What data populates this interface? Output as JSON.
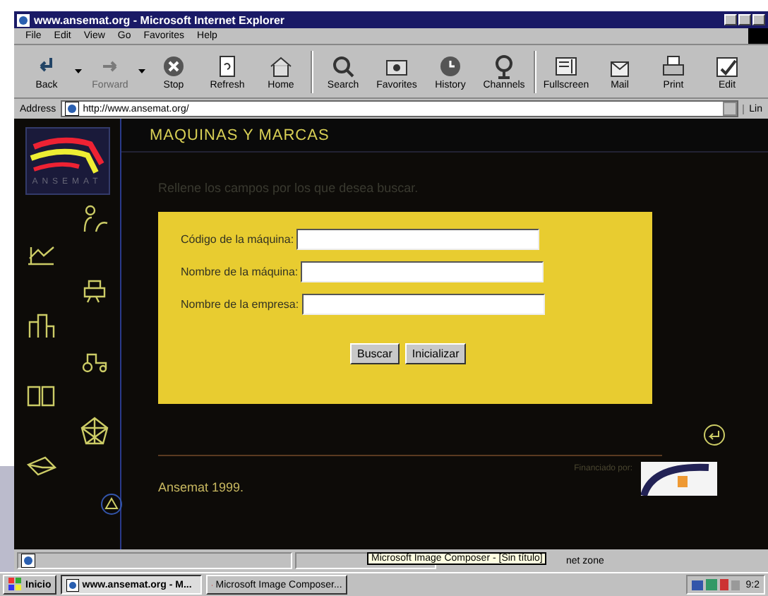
{
  "window": {
    "title": "www.ansemat.org - Microsoft Internet Explorer"
  },
  "menu": [
    "File",
    "Edit",
    "View",
    "Go",
    "Favorites",
    "Help"
  ],
  "toolbar": [
    {
      "label": "Back",
      "kind": "back",
      "disabled": false,
      "dropdown": true
    },
    {
      "label": "Forward",
      "kind": "forward",
      "disabled": true,
      "dropdown": true
    },
    {
      "label": "Stop",
      "kind": "stop",
      "disabled": false,
      "dropdown": false
    },
    {
      "label": "Refresh",
      "kind": "refresh",
      "disabled": false,
      "dropdown": false
    },
    {
      "label": "Home",
      "kind": "home",
      "disabled": false,
      "dropdown": false
    },
    {
      "label": "Search",
      "kind": "search",
      "disabled": false,
      "dropdown": false
    },
    {
      "label": "Favorites",
      "kind": "favorites",
      "disabled": false,
      "dropdown": false
    },
    {
      "label": "History",
      "kind": "history",
      "disabled": false,
      "dropdown": false
    },
    {
      "label": "Channels",
      "kind": "channels",
      "disabled": false,
      "dropdown": false
    },
    {
      "label": "Fullscreen",
      "kind": "fullscreen",
      "disabled": false,
      "dropdown": false
    },
    {
      "label": "Mail",
      "kind": "mail",
      "disabled": false,
      "dropdown": false
    },
    {
      "label": "Print",
      "kind": "print",
      "disabled": false,
      "dropdown": false
    },
    {
      "label": "Edit",
      "kind": "edit",
      "disabled": false,
      "dropdown": false
    }
  ],
  "address": {
    "label": "Address",
    "value": "http://www.ansemat.org/",
    "links": "Lin"
  },
  "page": {
    "logo_text": "ANSEMAT",
    "heading": "MAQUINAS Y MARCAS",
    "instruction": "Rellene los campos por los que desea buscar.",
    "fields": [
      {
        "label": "Código de la máquina:"
      },
      {
        "label": "Nombre de la máquina:"
      },
      {
        "label": "Nombre de la empresa:"
      }
    ],
    "buttons": [
      "Buscar",
      "Inicializar"
    ],
    "footer": {
      "copyright": "Ansemat 1999.",
      "funded_by": "Financiado por:"
    }
  },
  "status_bar": {
    "text": "net zone",
    "tooltip": "Microsoft Image Composer - [Sin título]"
  },
  "taskbar": {
    "start": "Inicio",
    "tasks": [
      {
        "label": "www.ansemat.org - M...",
        "selected": true
      },
      {
        "label": "Microsoft Image Composer...",
        "selected": false
      }
    ],
    "clock": "9:2"
  }
}
